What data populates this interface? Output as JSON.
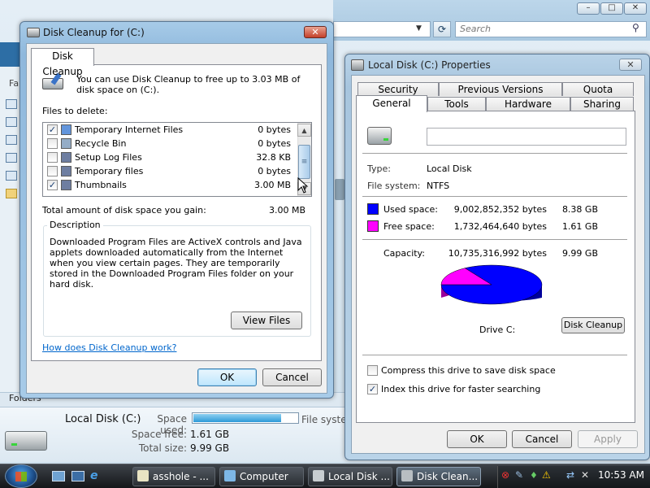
{
  "explorer": {
    "search_placeholder": "Search",
    "folders_label": "Folders",
    "left_label": "Fa",
    "details": {
      "title": "Local Disk (C:)",
      "space_used_label": "Space used:",
      "space_used_fraction": 0.84,
      "file_system_label": "File system",
      "space_free_label": "Space free:",
      "space_free_value": "1.61 GB",
      "total_size_label": "Total size:",
      "total_size_value": "9.99 GB"
    }
  },
  "cleanup": {
    "title": "Disk Cleanup for  (C:)",
    "tab": "Disk Cleanup",
    "intro": "You can use Disk Cleanup to free up to 3.03 MB of disk space on  (C:).",
    "files_to_delete_label": "Files to delete:",
    "files": [
      {
        "name": "Temporary Internet Files",
        "size": "0 bytes",
        "checked": true
      },
      {
        "name": "Recycle Bin",
        "size": "0 bytes",
        "checked": false
      },
      {
        "name": "Setup Log Files",
        "size": "32.8 KB",
        "checked": false
      },
      {
        "name": "Temporary files",
        "size": "0 bytes",
        "checked": false
      },
      {
        "name": "Thumbnails",
        "size": "3.00 MB",
        "checked": true
      }
    ],
    "total_label": "Total amount of disk space you gain:",
    "total_value": "3.00 MB",
    "description_label": "Description",
    "description_text": "Downloaded Program Files are ActiveX controls and Java applets downloaded automatically from the Internet when you view certain pages. They are temporarily stored in the Downloaded Program Files folder on your hard disk.",
    "view_files": "View Files",
    "help_link": "How does Disk Cleanup work?",
    "ok": "OK",
    "cancel": "Cancel"
  },
  "properties": {
    "title": "Local Disk (C:) Properties",
    "tabs_row1": [
      "Security",
      "Previous Versions",
      "Quota"
    ],
    "tabs_row2": [
      "General",
      "Tools",
      "Hardware",
      "Sharing"
    ],
    "label_value": "",
    "type_label": "Type:",
    "type_value": "Local Disk",
    "fs_label": "File system:",
    "fs_value": "NTFS",
    "used_label": "Used space:",
    "used_bytes": "9,002,852,352 bytes",
    "used_gb": "8.38 GB",
    "free_label": "Free space:",
    "free_bytes": "1,732,464,640 bytes",
    "free_gb": "1.61 GB",
    "capacity_label": "Capacity:",
    "capacity_bytes": "10,735,316,992 bytes",
    "capacity_gb": "9.99 GB",
    "drive_label": "Drive C:",
    "disk_cleanup": "Disk Cleanup",
    "compress_label": "Compress this drive to save disk space",
    "compress_checked": false,
    "index_label": "Index this drive for faster searching",
    "index_checked": true,
    "ok": "OK",
    "cancel": "Cancel",
    "apply": "Apply",
    "colors": {
      "used": "#0000ff",
      "free": "#ff00ff"
    }
  },
  "taskbar": {
    "buttons": [
      "asshole - ...",
      "Computer",
      "Local Disk ...",
      "Disk Clean..."
    ],
    "clock": "10:53 AM"
  }
}
